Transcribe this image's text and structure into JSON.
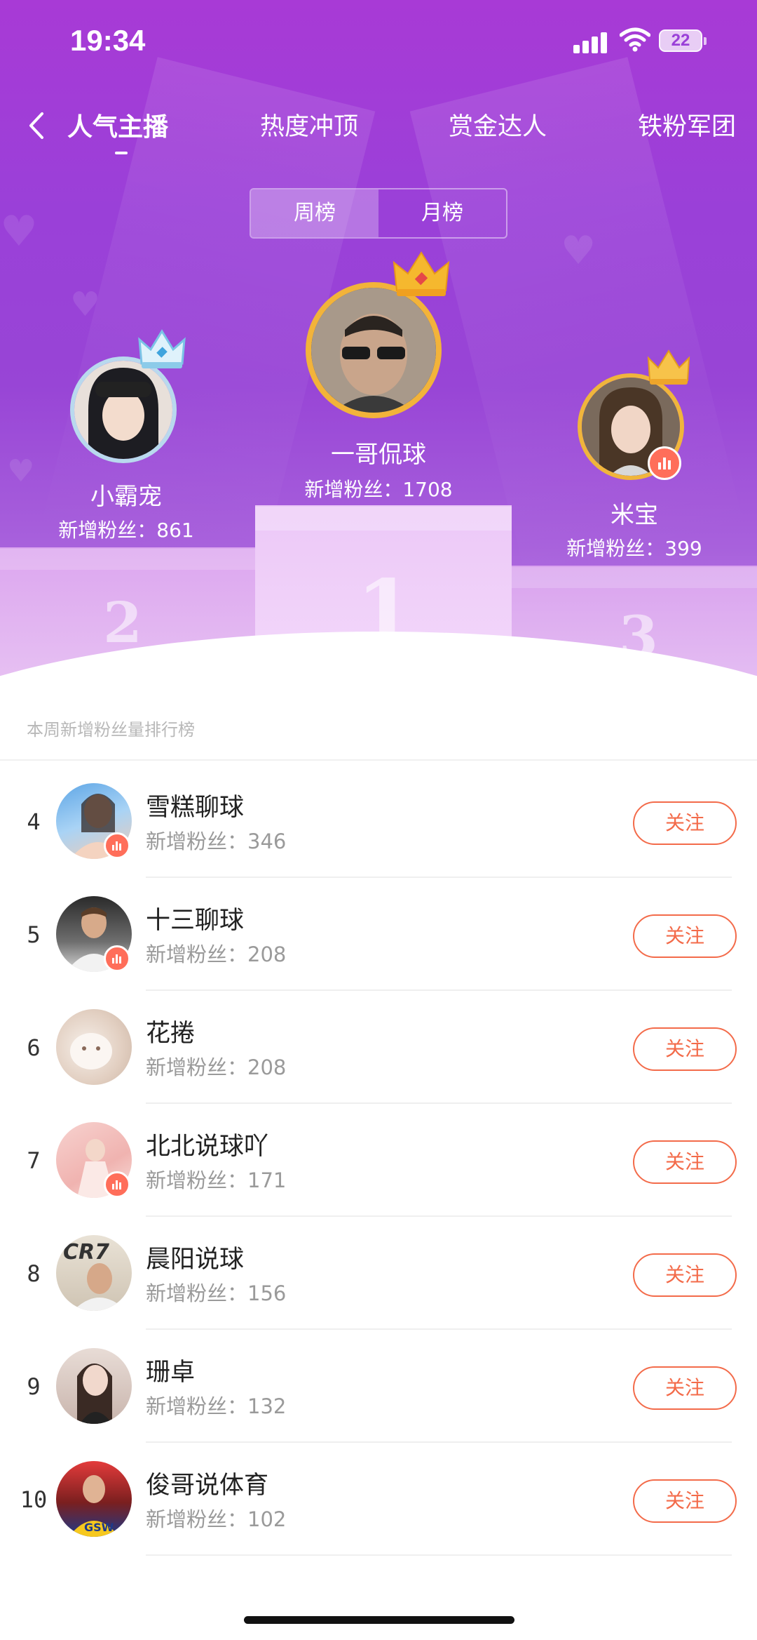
{
  "status_bar": {
    "time": "19:34",
    "battery": "22"
  },
  "nav": {
    "tabs": [
      "人气主播",
      "热度冲顶",
      "赏金达人",
      "铁粉军团"
    ],
    "active_tab": "人气主播"
  },
  "period_toggle": {
    "options": [
      "周榜",
      "月榜"
    ],
    "selected": "周榜"
  },
  "podium": [
    {
      "rank": "1",
      "name": "一哥侃球",
      "fans_label": "新增粉丝：1708",
      "crown_color": "#f5b82e"
    },
    {
      "rank": "2",
      "name": "小霸宠",
      "fans_label": "新增粉丝：861",
      "crown_color": "#9ad2f0"
    },
    {
      "rank": "3",
      "name": "米宝",
      "fans_label": "新增粉丝：399",
      "crown_color": "#f0b53c"
    }
  ],
  "list_title": "本周新增粉丝量排行榜",
  "follow_label": "关注",
  "ranking": [
    {
      "rank": "4",
      "name": "雪糕聊球",
      "fans": "新增粉丝：346",
      "live": true
    },
    {
      "rank": "5",
      "name": "十三聊球",
      "fans": "新增粉丝：208",
      "live": true
    },
    {
      "rank": "6",
      "name": "花捲",
      "fans": "新增粉丝：208",
      "live": false
    },
    {
      "rank": "7",
      "name": "北北说球吖",
      "fans": "新增粉丝：171",
      "live": true
    },
    {
      "rank": "8",
      "name": "晨阳说球",
      "fans": "新增粉丝：156",
      "live": false
    },
    {
      "rank": "9",
      "name": "珊卓",
      "fans": "新增粉丝：132",
      "live": false
    },
    {
      "rank": "10",
      "name": "俊哥说体育",
      "fans": "新增粉丝：102",
      "live": false
    }
  ],
  "colors": {
    "accent": "#f36b4a",
    "hero_top": "#a83ad6",
    "live_badge": "#ff6e5a"
  }
}
